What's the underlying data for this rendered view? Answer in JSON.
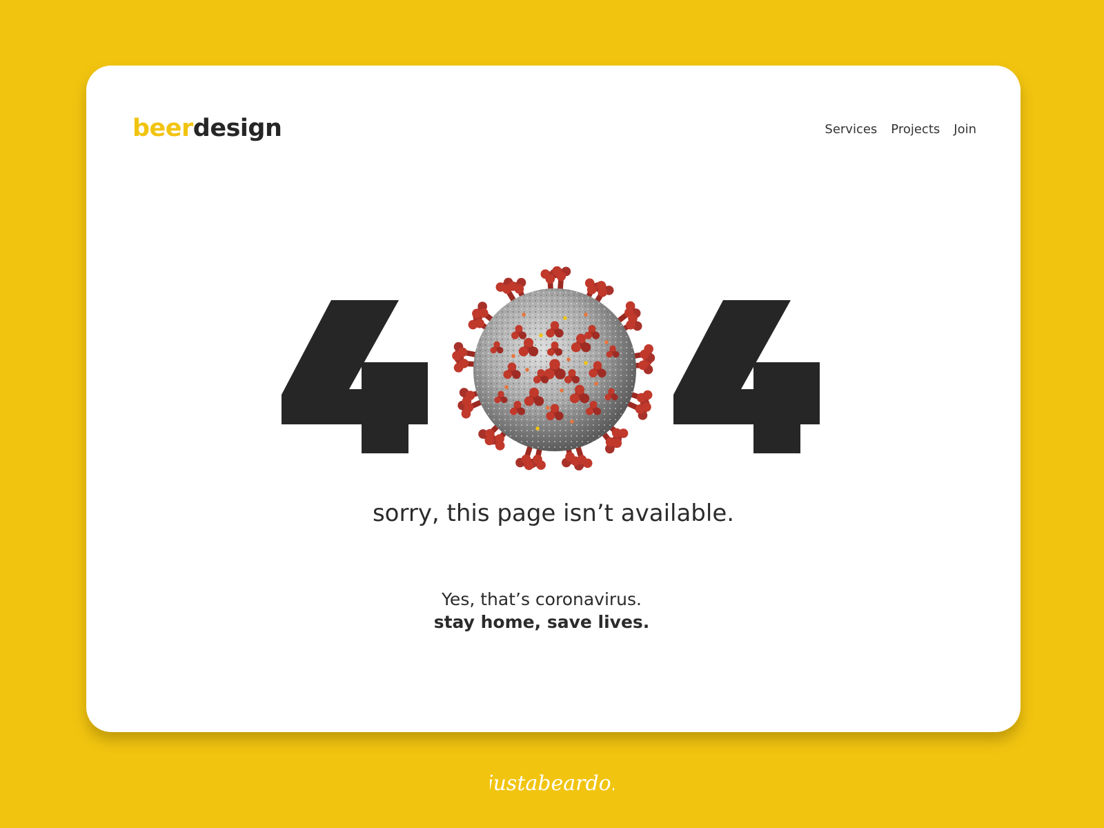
{
  "brand": {
    "logo_part1": "beer",
    "logo_part2": "design",
    "accent_color": "#f1c410",
    "dark_color": "#262626"
  },
  "nav": {
    "items": [
      {
        "label": "Services"
      },
      {
        "label": "Projects"
      },
      {
        "label": "Join"
      }
    ]
  },
  "error": {
    "code_first_digit": "4",
    "code_middle_icon": "coronavirus-icon",
    "code_last_digit": "4",
    "message": "sorry, this page isn’t available."
  },
  "info": {
    "line1": "Yes, that’s coronavirus.",
    "line2": "stay home, save lives."
  },
  "signature": {
    "text": "justabeardo."
  }
}
